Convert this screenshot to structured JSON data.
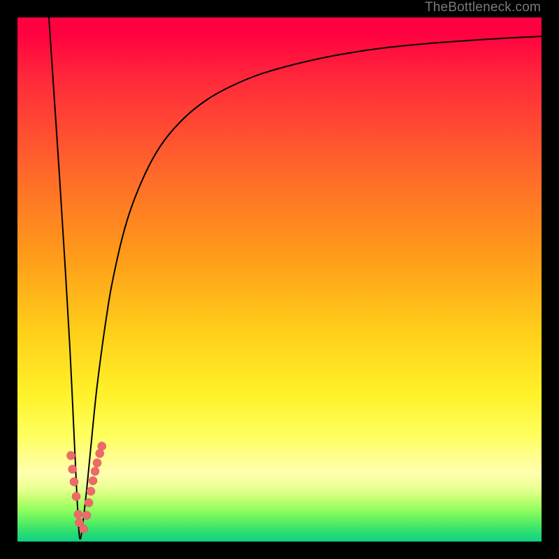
{
  "watermark": "TheBottleneck.com",
  "colors": {
    "curve": "#000000",
    "dots": "#ee6a6a",
    "dot_stroke": "rgba(0,0,0,0.15)"
  },
  "chart_data": {
    "type": "line",
    "title": "",
    "xlabel": "",
    "ylabel": "",
    "xlim": [
      0,
      100
    ],
    "ylim": [
      0,
      100
    ],
    "series": [
      {
        "name": "bottleneck-curve",
        "x": [
          6.0,
          7.0,
          8.0,
          9.0,
          10.0,
          11.0,
          11.5,
          12.0,
          13.0,
          14.0,
          15.0,
          16.0,
          17.0,
          18.0,
          20.0,
          22.0,
          25.0,
          28.0,
          32.0,
          36.0,
          40.0,
          45.0,
          50.0,
          56.0,
          62.0,
          70.0,
          78.0,
          86.0,
          94.0,
          100.0
        ],
        "values": [
          100.0,
          85.0,
          70.0,
          54.0,
          37.0,
          16.0,
          6.0,
          0.5,
          8.0,
          18.0,
          28.0,
          36.0,
          43.0,
          49.0,
          58.0,
          64.5,
          71.5,
          76.5,
          81.0,
          84.2,
          86.5,
          88.7,
          90.3,
          91.8,
          93.0,
          94.2,
          95.0,
          95.6,
          96.1,
          96.4
        ]
      }
    ],
    "points": {
      "name": "highlighted-dots",
      "x": [
        10.2,
        10.5,
        10.8,
        11.2,
        11.6,
        11.8,
        12.6,
        13.2,
        13.6,
        14.0,
        14.4,
        14.8,
        15.2,
        15.7,
        16.1
      ],
      "y": [
        16.4,
        13.8,
        11.4,
        8.6,
        5.2,
        3.6,
        2.4,
        5.0,
        7.4,
        9.6,
        11.6,
        13.4,
        15.0,
        16.8,
        18.2
      ]
    }
  }
}
